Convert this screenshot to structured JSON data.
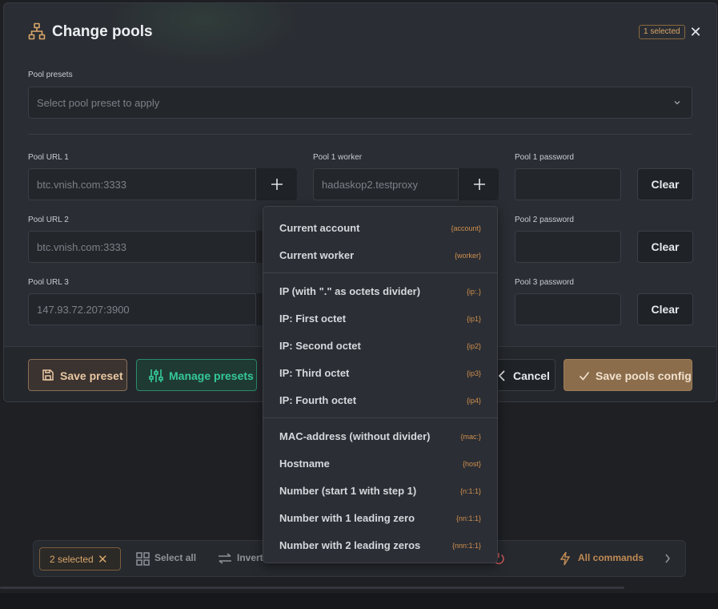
{
  "modal": {
    "title": "Change pools",
    "selected_badge": "1 selected",
    "close_symbol": "✕",
    "icons": {
      "title": "network-tree-icon",
      "close": "close-icon"
    }
  },
  "presets": {
    "label": "Pool presets",
    "placeholder": "Select pool preset to apply"
  },
  "pools": [
    {
      "url_label": "Pool URL 1",
      "url": "btc.vnish.com:3333",
      "worker_label": "Pool 1 worker",
      "worker": "hadaskop2.testproxy",
      "password_label": "Pool 1 password",
      "password": "",
      "clear": "Clear"
    },
    {
      "url_label": "Pool URL 2",
      "url": "btc.vnish.com:3333",
      "password_label": "Pool 2 password",
      "password": "",
      "clear": "Clear"
    },
    {
      "url_label": "Pool URL 3",
      "url": "147.93.72.207:3900",
      "password_label": "Pool 3 password",
      "password": "",
      "clear": "Clear"
    }
  ],
  "footer": {
    "save_preset": "Save preset",
    "manage_presets": "Manage presets",
    "cancel": "Cancel",
    "save_config": "Save pools config"
  },
  "placeholder_menu": {
    "groups": [
      [
        {
          "label": "Current account",
          "tag": "{account}"
        },
        {
          "label": "Current worker",
          "tag": "{worker}"
        }
      ],
      [
        {
          "label": "IP (with \".\" as octets divider)",
          "tag": "{ip:.}"
        },
        {
          "label": "IP: First octet",
          "tag": "{ip1}"
        },
        {
          "label": "IP: Second octet",
          "tag": "{ip2}"
        },
        {
          "label": "IP: Third octet",
          "tag": "{ip3}"
        },
        {
          "label": "IP: Fourth octet",
          "tag": "{ip4}"
        }
      ],
      [
        {
          "label": "MAC-address (without divider)",
          "tag": "{mac:}"
        },
        {
          "label": "Hostname",
          "tag": "{host}"
        },
        {
          "label": "Number (start 1 with step 1)",
          "tag": "{n:1:1}"
        },
        {
          "label": "Number with 1 leading zero",
          "tag": "{nn:1:1}"
        },
        {
          "label": "Number with 2 leading zeros",
          "tag": "{nnn:1:1}"
        }
      ]
    ]
  },
  "toolbar": {
    "selected": "2 selected",
    "select_all": "Select all",
    "invert": "Invert",
    "all_commands": "All commands"
  },
  "colors": {
    "accent_orange": "#d9a66a",
    "accent_green": "#35c89a",
    "modal_bg": "#2a2d33"
  }
}
